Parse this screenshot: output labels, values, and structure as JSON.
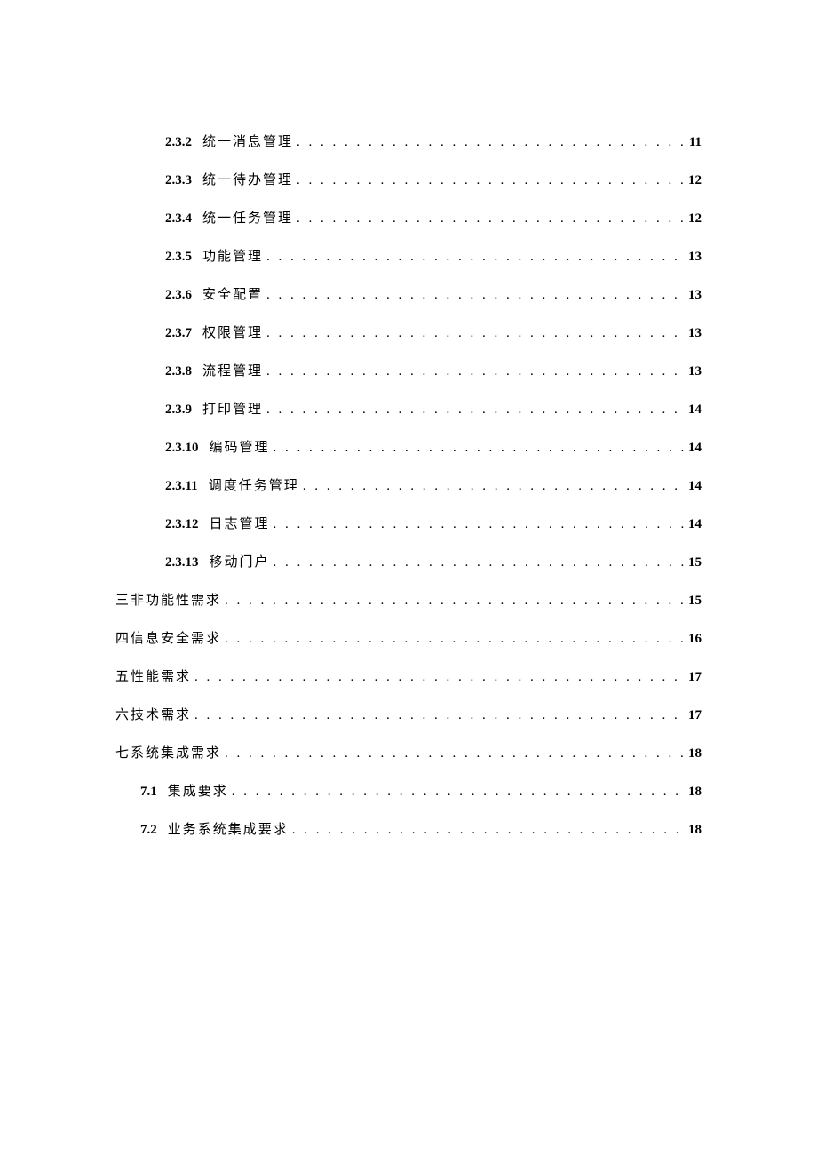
{
  "toc": [
    {
      "level": 3,
      "number": "2.3.2",
      "title": "统一消息管理",
      "page": "11"
    },
    {
      "level": 3,
      "number": "2.3.3",
      "title": "统一待办管理",
      "page": "12"
    },
    {
      "level": 3,
      "number": "2.3.4",
      "title": "统一任务管理",
      "page": "12"
    },
    {
      "level": 3,
      "number": "2.3.5",
      "title": "功能管理",
      "page": "13"
    },
    {
      "level": 3,
      "number": "2.3.6",
      "title": "安全配置",
      "page": "13"
    },
    {
      "level": 3,
      "number": "2.3.7",
      "title": "权限管理",
      "page": "13"
    },
    {
      "level": 3,
      "number": "2.3.8",
      "title": "流程管理",
      "page": "13"
    },
    {
      "level": 3,
      "number": "2.3.9",
      "title": "打印管理",
      "page": "14"
    },
    {
      "level": 3,
      "number": "2.3.10",
      "title": "编码管理",
      "page": "14"
    },
    {
      "level": 3,
      "number": "2.3.11",
      "title": "调度任务管理",
      "page": "14"
    },
    {
      "level": 3,
      "number": "2.3.12",
      "title": "日志管理",
      "page": "14"
    },
    {
      "level": 3,
      "number": "2.3.13",
      "title": "移动门户",
      "page": "15"
    },
    {
      "level": 1,
      "number": "",
      "title": "三非功能性需求",
      "page": "15"
    },
    {
      "level": 1,
      "number": "",
      "title": "四信息安全需求",
      "page": "16"
    },
    {
      "level": 1,
      "number": "",
      "title": "五性能需求",
      "page": "17"
    },
    {
      "level": 1,
      "number": "",
      "title": "六技术需求",
      "page": "17"
    },
    {
      "level": 1,
      "number": "",
      "title": "七系统集成需求",
      "page": "18"
    },
    {
      "level": 2,
      "number": "7.1",
      "title": "集成要求",
      "page": "18"
    },
    {
      "level": 2,
      "number": "7.2",
      "title": "业务系统集成要求",
      "page": "18"
    }
  ],
  "dots": ". . . . . . . . . . . . . . . . . . . . . . . . . . . . . . . . . . . . . . . . . . . . . . . . . . . . . . . . . . . . . . . . . . . . . . . . . . . . . . . . . . . . . . . . . . . . . . . . . . . ."
}
